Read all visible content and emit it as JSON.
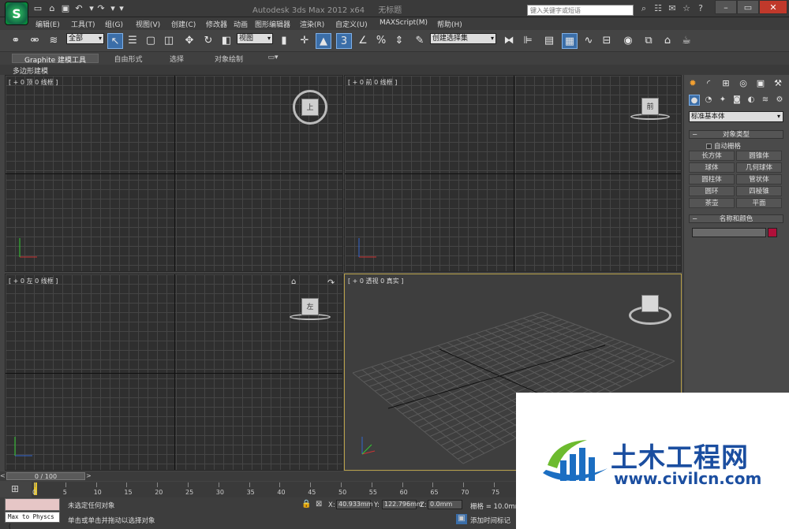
{
  "titlebar": {
    "app_name": "Autodesk 3ds Max  2012 x64",
    "doc_title": "无标题",
    "search_placeholder": "键入关键字或短语",
    "logo": "3ds-max-logo",
    "quick_access_icons": [
      "new-icon",
      "open-icon",
      "save-icon",
      "undo-icon",
      "redo-icon",
      "dropdown-icon"
    ],
    "window_controls": [
      "minimize",
      "maximize",
      "close"
    ]
  },
  "menu": {
    "items": [
      "编辑(E)",
      "工具(T)",
      "组(G)",
      "视图(V)",
      "创建(C)",
      "修改器",
      "动画",
      "图形编辑器",
      "渲染(R)",
      "自定义(U)",
      "MAXScript(M)",
      "帮助(H)"
    ]
  },
  "toolbar": {
    "selection_filter": "全部",
    "reference_coord": "视图",
    "named_selection_placeholder": "创建选择集",
    "snap_label": "3"
  },
  "ribbon": {
    "tabs": [
      "Graphite 建模工具",
      "自由形式",
      "选择",
      "对象绘制"
    ],
    "active_panel": "多边形建模"
  },
  "viewports": {
    "top": "[ + 0 顶 0 线框 ]",
    "front": "[ + 0 前 0 线框 ]",
    "left": "[ + 0 左 0 线框 ]",
    "perspective": "[ + 0 透视 0 真实 ]",
    "cube_top": "上",
    "cube_front": "前",
    "cube_left": "左"
  },
  "command_panel": {
    "category": "标准基本体",
    "object_type_header": "对象类型",
    "autogrid_label": "自动栅格",
    "object_buttons": [
      "长方体",
      "圆锥体",
      "球体",
      "几何球体",
      "圆柱体",
      "管状体",
      "圆环",
      "四棱锥",
      "茶壶",
      "平面"
    ],
    "name_color_header": "名称和颜色",
    "object_color": "#b0103a"
  },
  "timeline": {
    "frame_display": "0 / 100",
    "ticks": [
      "0",
      "5",
      "10",
      "15",
      "20",
      "25",
      "30",
      "35",
      "40",
      "45",
      "50",
      "55",
      "60",
      "65",
      "70",
      "75"
    ]
  },
  "status": {
    "selection_status": "未选定任何对象",
    "prompt": "单击或单击并拖动以选择对象",
    "maxscript_text": "Max to Physcs (",
    "x_label": "X:",
    "x_value": "40.933mm",
    "y_label": "Y:",
    "y_value": "122.796mm",
    "z_label": "Z:",
    "z_value": "0.0mm",
    "grid": "栅格 = 10.0mm",
    "add_time_tag": "添加时间标记"
  },
  "watermark": {
    "brand_cn": "土木工程网",
    "url": "www.civilcn.com"
  }
}
